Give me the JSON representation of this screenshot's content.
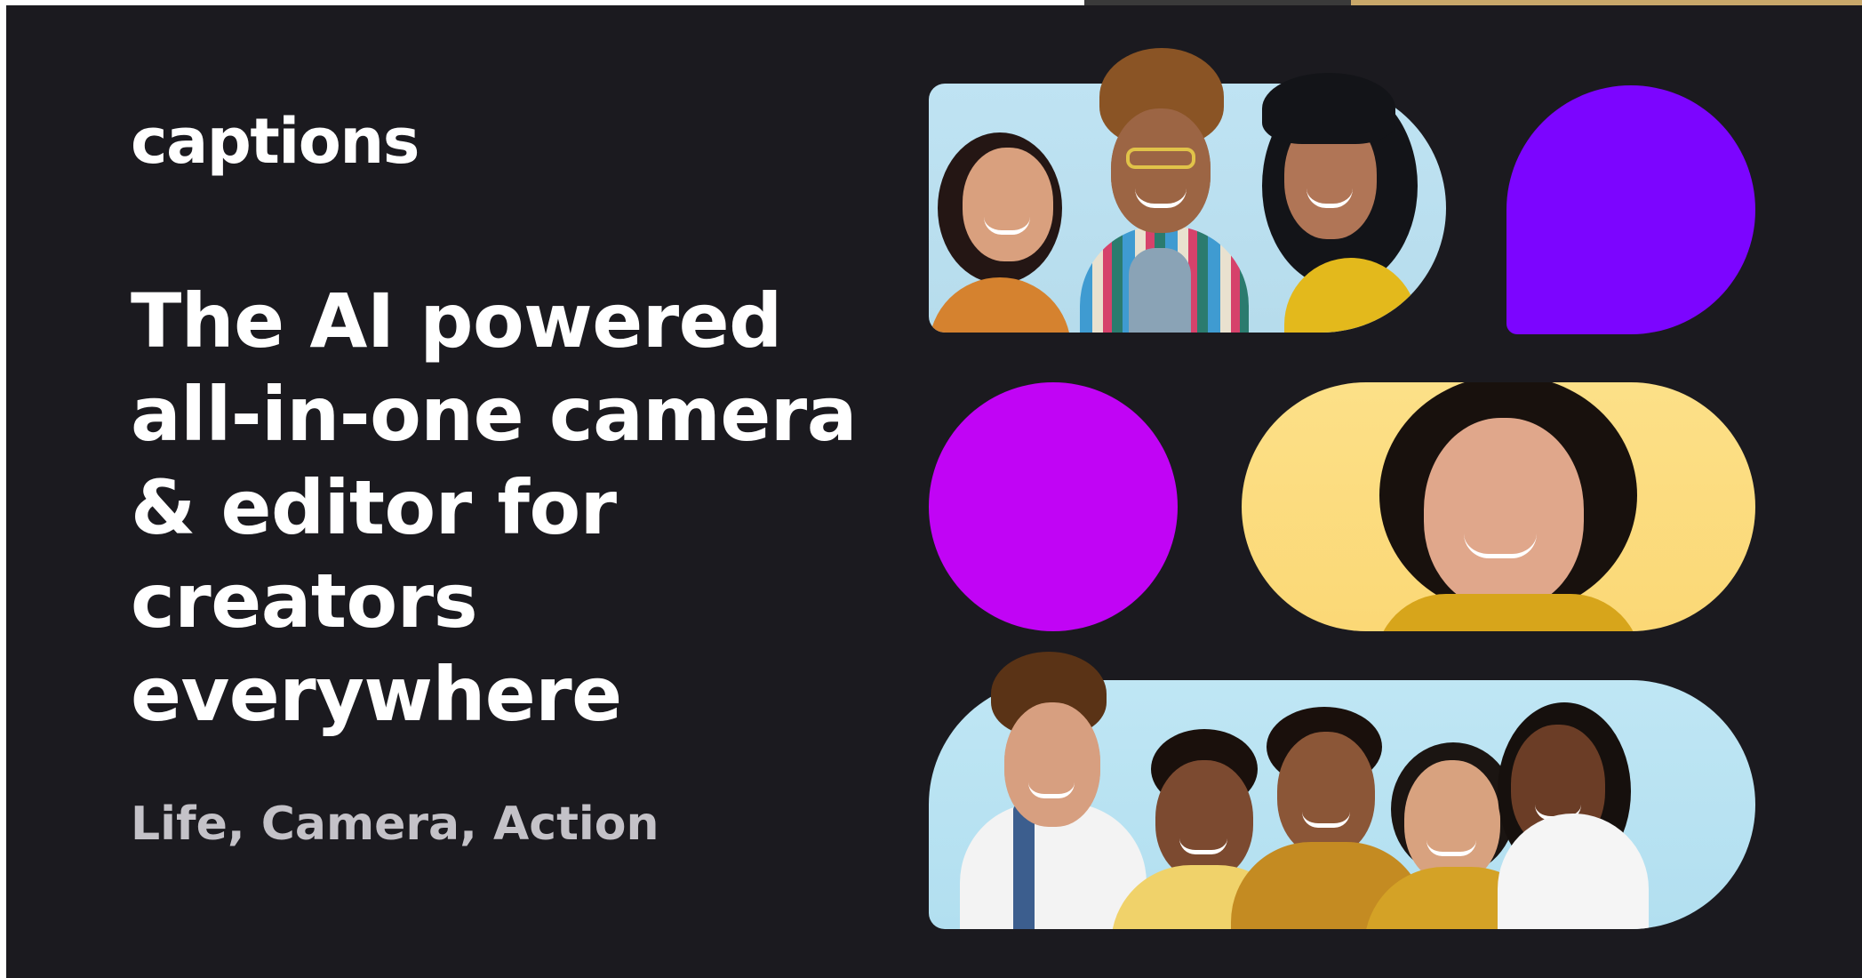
{
  "brand": {
    "logo_text": "captions"
  },
  "hero": {
    "headline_lines": [
      "The AI powered",
      "all-in-one camera",
      "& editor for",
      "creators",
      "everywhere"
    ],
    "tagline": "Life, Camera, Action"
  },
  "colors": {
    "background": "#1b1a1f",
    "violet": "#7c05ff",
    "magenta": "#c104f5",
    "yellow": "#fcdc80",
    "sky": "#bfe3f3"
  },
  "tiles": {
    "photo_group_top": "group-of-three-friends-photo",
    "bubble": "purple-speech-bubble-shape",
    "circle": "magenta-circle-shape",
    "photo_portrait": "smiling-young-man-portrait-photo",
    "photo_group_bottom": "group-of-five-friends-photo"
  }
}
